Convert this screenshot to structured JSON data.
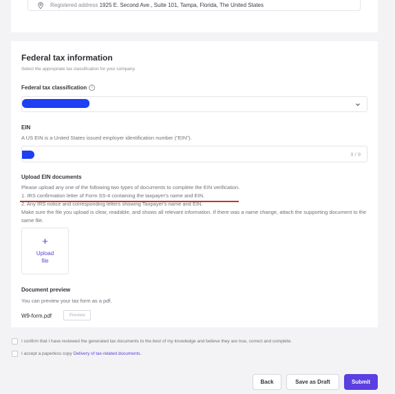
{
  "address": {
    "label": "Registered address",
    "value": "1925 E. Second Ave., Suite 101, Tampa, Florida, The United States"
  },
  "federal_tax": {
    "title": "Federal tax information",
    "subtitle": "Select the appropriate tax classification for your company.",
    "classification_label": "Federal tax classification",
    "info_glyph": "i",
    "chevron_icon": "chevron-down-icon"
  },
  "ein": {
    "label": "EIN",
    "help": "A US EIN is a United States issued employer identification number (\"EIN\").",
    "counter": "9 / 9"
  },
  "upload_docs": {
    "label": "Upload EIN documents",
    "line1": "Please upload any one of the following two types of documents to complete the EIN verification.",
    "line2": "1. IRS confirmation letter of Form SS-4 containing the taxpayer's name and EIN.",
    "line3": "2. Any IRS notice and corresponding letters showing Taxpayer's name and EIN.",
    "line4": "Make sure the file you upload is clear, readable, and shows all relevant information. If there was a name change, attach the supporting document to the same file.",
    "upload_plus": "+",
    "upload_line1": "Upload",
    "upload_line2": "file"
  },
  "doc_preview": {
    "label": "Document preview",
    "help": "You can preview your tax form as a pdf.",
    "filename": "W9-form.pdf",
    "preview_button": "Preview"
  },
  "confirmations": {
    "confirm_text": "I confirm that I have reviewed the generated tax documents to the best of my knowledge and believe they are true, correct and complete.",
    "paperless_text": "I accept a paperless copy",
    "paperless_link": "Delivery of tax-related documents."
  },
  "actions": {
    "back": "Back",
    "save_draft": "Save as Draft",
    "submit": "Submit"
  },
  "colors": {
    "accent": "#5b3fe0",
    "annotation_red": "#d12a2a",
    "redaction_blue": "#1e3ff2"
  }
}
